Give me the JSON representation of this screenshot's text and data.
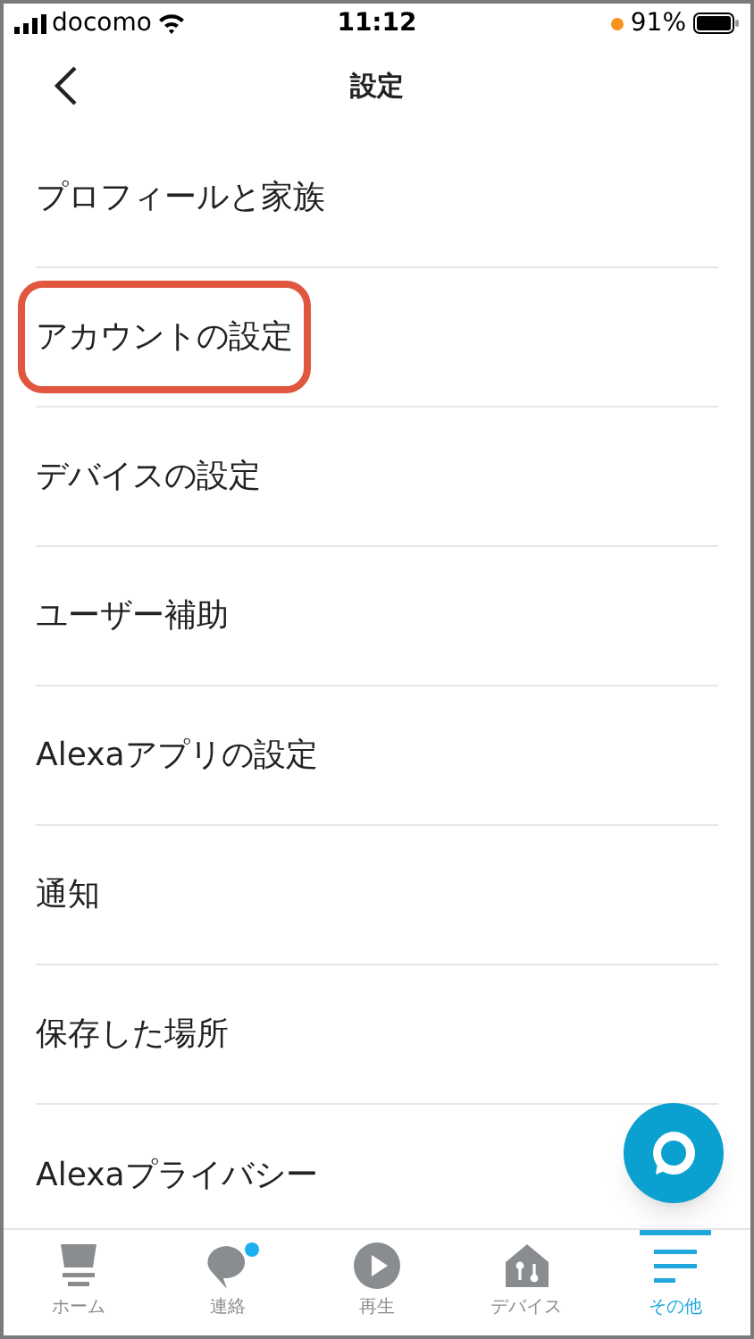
{
  "status_bar": {
    "carrier": "docomo",
    "time": "11:12",
    "battery": "91%"
  },
  "header": {
    "title": "設定"
  },
  "items": [
    {
      "label": "プロフィールと家族",
      "highlighted": false
    },
    {
      "label": "アカウントの設定",
      "highlighted": true
    },
    {
      "label": "デバイスの設定",
      "highlighted": false
    },
    {
      "label": "ユーザー補助",
      "highlighted": false
    },
    {
      "label": "Alexaアプリの設定",
      "highlighted": false
    },
    {
      "label": "通知",
      "highlighted": false
    },
    {
      "label": "保存した場所",
      "highlighted": false
    },
    {
      "label": "Alexaプライバシー",
      "highlighted": false
    }
  ],
  "tabs": [
    {
      "kind": "home",
      "label": "ホーム",
      "selected": false,
      "badge": false
    },
    {
      "kind": "chat",
      "label": "連絡",
      "selected": false,
      "badge": true
    },
    {
      "kind": "play",
      "label": "再生",
      "selected": false,
      "badge": false
    },
    {
      "kind": "devices",
      "label": "デバイス",
      "selected": false,
      "badge": false
    },
    {
      "kind": "more",
      "label": "その他",
      "selected": true,
      "badge": false
    }
  ]
}
